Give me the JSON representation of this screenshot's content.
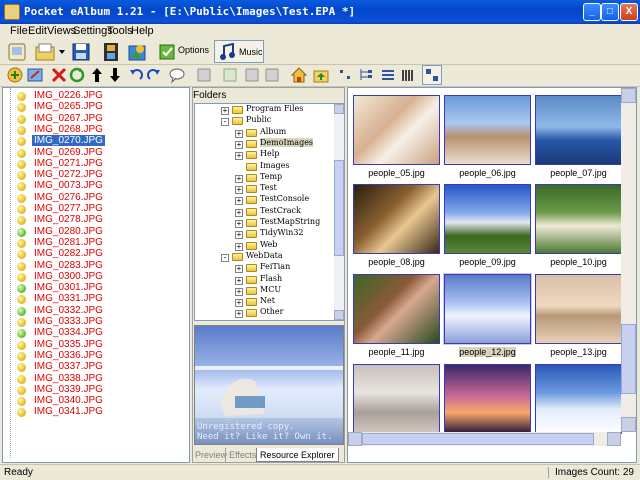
{
  "window": {
    "title": "Pocket eAlbum 1.21 - [E:\\Public\\Images\\Test.EPA *]",
    "minimize": "_",
    "maximize": "□",
    "close": "X"
  },
  "menu": [
    "File",
    "Edit",
    "Views",
    "Settings",
    "Tools",
    "Help"
  ],
  "toolbar1": {
    "options_label": "Options",
    "music_label": "Music"
  },
  "file_list": [
    {
      "name": "IMG_0226.JPG",
      "dot": "yellow"
    },
    {
      "name": "IMG_0265.JPG",
      "dot": "yellow"
    },
    {
      "name": "IMG_0267.JPG",
      "dot": "yellow"
    },
    {
      "name": "IMG_0268.JPG",
      "dot": "yellow"
    },
    {
      "name": "IMG_0270.JPG",
      "dot": "yellow",
      "selected": true
    },
    {
      "name": "IMG_0269.JPG",
      "dot": "yellow"
    },
    {
      "name": "IMG_0271.JPG",
      "dot": "yellow"
    },
    {
      "name": "IMG_0272.JPG",
      "dot": "yellow"
    },
    {
      "name": "IMG_0073.JPG",
      "dot": "yellow"
    },
    {
      "name": "IMG_0276.JPG",
      "dot": "yellow"
    },
    {
      "name": "IMG_0277.JPG",
      "dot": "yellow"
    },
    {
      "name": "IMG_0278.JPG",
      "dot": "yellow"
    },
    {
      "name": "IMG_0280.JPG",
      "dot": "green"
    },
    {
      "name": "IMG_0281.JPG",
      "dot": "yellow"
    },
    {
      "name": "IMG_0282.JPG",
      "dot": "yellow"
    },
    {
      "name": "IMG_0283.JPG",
      "dot": "yellow"
    },
    {
      "name": "IMG_0300.JPG",
      "dot": "yellow"
    },
    {
      "name": "IMG_0301.JPG",
      "dot": "green"
    },
    {
      "name": "IMG_0331.JPG",
      "dot": "yellow"
    },
    {
      "name": "IMG_0332.JPG",
      "dot": "green"
    },
    {
      "name": "IMG_0333.JPG",
      "dot": "yellow"
    },
    {
      "name": "IMG_0334.JPG",
      "dot": "green"
    },
    {
      "name": "IMG_0335.JPG",
      "dot": "yellow"
    },
    {
      "name": "IMG_0336.JPG",
      "dot": "yellow"
    },
    {
      "name": "IMG_0337.JPG",
      "dot": "yellow"
    },
    {
      "name": "IMG_0338.JPG",
      "dot": "yellow"
    },
    {
      "name": "IMG_0339.JPG",
      "dot": "yellow"
    },
    {
      "name": "IMG_0340.JPG",
      "dot": "yellow"
    },
    {
      "name": "IMG_0341.JPG",
      "dot": "yellow"
    }
  ],
  "folders": {
    "header": "Folders",
    "tree": [
      {
        "label": "Program Files",
        "level": 1,
        "expander": "+"
      },
      {
        "label": "Public",
        "level": 1,
        "expander": "-"
      },
      {
        "label": "Album",
        "level": 2,
        "expander": "+"
      },
      {
        "label": "DemoImages",
        "level": 2,
        "expander": "+",
        "highlighted": true
      },
      {
        "label": "Help",
        "level": 2,
        "expander": "+"
      },
      {
        "label": "Images",
        "level": 2,
        "expander": ""
      },
      {
        "label": "Temp",
        "level": 2,
        "expander": "+"
      },
      {
        "label": "Test",
        "level": 2,
        "expander": "+"
      },
      {
        "label": "TestConsole",
        "level": 2,
        "expander": "+"
      },
      {
        "label": "TestCrack",
        "level": 2,
        "expander": "+"
      },
      {
        "label": "TestMapString",
        "level": 2,
        "expander": "+"
      },
      {
        "label": "TidyWin32",
        "level": 2,
        "expander": "+"
      },
      {
        "label": "Web",
        "level": 2,
        "expander": "+"
      },
      {
        "label": "WebData",
        "level": 1,
        "expander": "-"
      },
      {
        "label": "FeiTian",
        "level": 2,
        "expander": "+"
      },
      {
        "label": "Flash",
        "level": 2,
        "expander": "+"
      },
      {
        "label": "MCU",
        "level": 2,
        "expander": "+"
      },
      {
        "label": "Net",
        "level": 2,
        "expander": "+"
      },
      {
        "label": "Other",
        "level": 2,
        "expander": "+"
      }
    ]
  },
  "preview": {
    "watermark_line1": "Unregistered copy.",
    "watermark_line2": "Need it? Like it? Own it."
  },
  "tabs": [
    "Preview",
    "Effects",
    "Resource Explorer"
  ],
  "active_tab": "Resource Explorer",
  "thumbnails": [
    {
      "name": "people_05.jpg",
      "style": "ph1"
    },
    {
      "name": "people_06.jpg",
      "style": "ph2"
    },
    {
      "name": "people_07.jpg",
      "style": "ph3"
    },
    {
      "name": "people_08.jpg",
      "style": "ph4"
    },
    {
      "name": "people_09.jpg",
      "style": "ph5"
    },
    {
      "name": "people_10.jpg",
      "style": "ph6"
    },
    {
      "name": "people_11.jpg",
      "style": "ph7"
    },
    {
      "name": "people_12.jpg",
      "style": "ph8",
      "selected": true
    },
    {
      "name": "people_13.jpg",
      "style": "ph9"
    },
    {
      "name": "",
      "style": "ph10"
    },
    {
      "name": "",
      "style": "ph11"
    },
    {
      "name": "",
      "style": "ph12"
    }
  ],
  "status": {
    "left": "Ready",
    "right": "Images Count: 29"
  },
  "colors": {
    "title_bar": "#0a5be0",
    "file_text": "#e00000",
    "selection": "#316ac5",
    "thumb_border": "#3a3ab8"
  }
}
